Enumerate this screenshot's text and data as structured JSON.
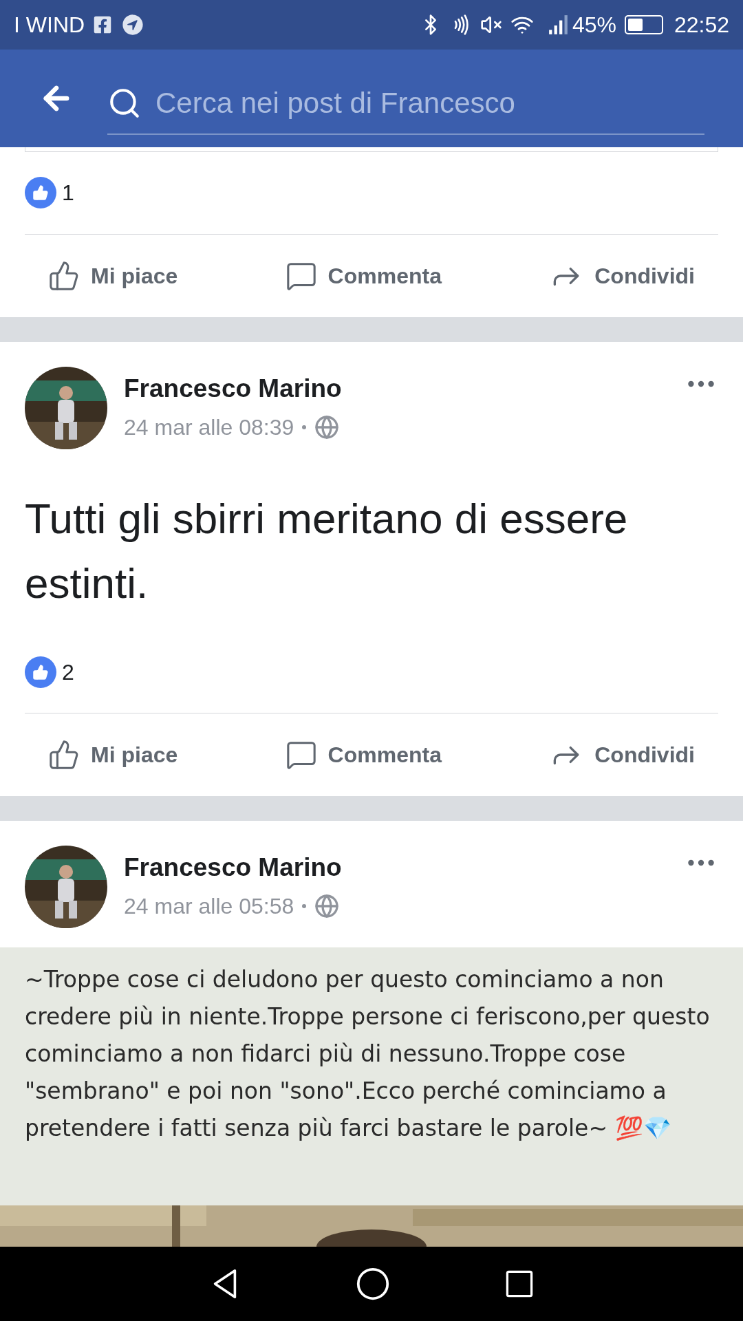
{
  "status_bar": {
    "carrier": "I WIND",
    "battery": {
      "label": "45%",
      "level": 0.45
    },
    "time": "22:52"
  },
  "header": {
    "search": {
      "placeholder": "Cerca nei post di Francesco"
    }
  },
  "partial_post": {
    "likes": "1",
    "actions": [
      {
        "kind": "like",
        "label": "Mi piace"
      },
      {
        "kind": "comment",
        "label": "Commenta"
      },
      {
        "kind": "share",
        "label": "Condividi"
      }
    ]
  },
  "posts": [
    {
      "author": "Francesco Marino",
      "time": "24 mar alle 08:39",
      "text": "Tutti gli sbirri meritano di essere estinti.",
      "likes": "2",
      "actions": [
        {
          "kind": "like",
          "label": "Mi piace"
        },
        {
          "kind": "comment",
          "label": "Commenta"
        },
        {
          "kind": "share",
          "label": "Condividi"
        }
      ]
    },
    {
      "author": "Francesco Marino",
      "time": "24 mar alle 05:58",
      "image_text": "~Troppe cose ci deludono per questo cominciamo a non credere più in niente.Troppe persone ci feriscono,per questo  cominciamo a non fidarci più di nessuno.Troppe cose \"sembrano\" e poi non \"sono\".Ecco perché cominciamo a pretendere i fatti senza più farci bastare le parole~ 💯💎"
    }
  ]
}
